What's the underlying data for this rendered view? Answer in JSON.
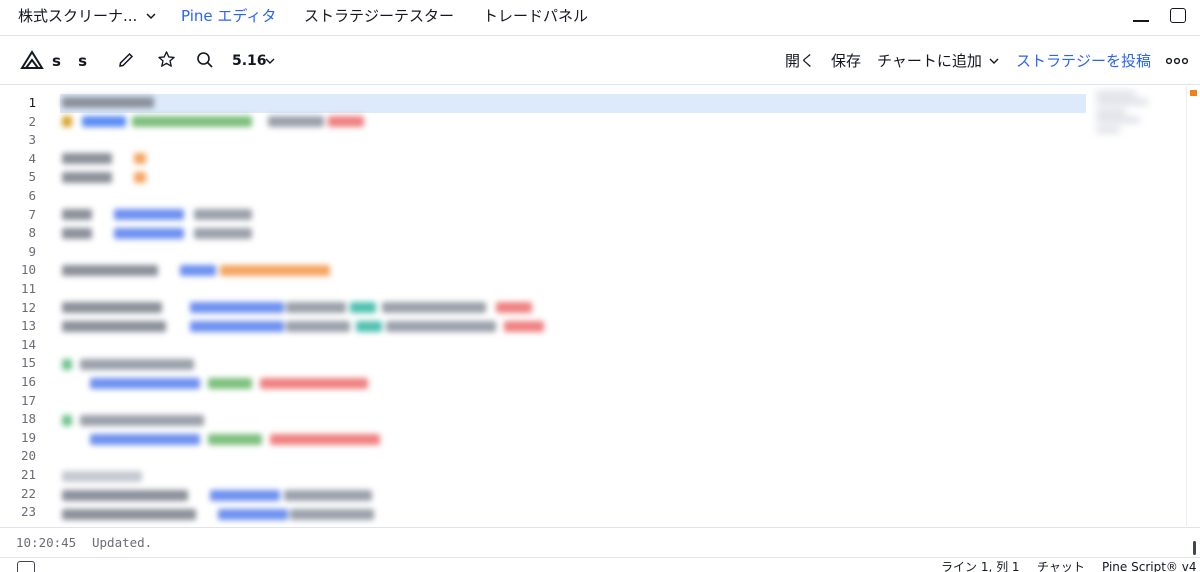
{
  "tabs": {
    "screener": "株式スクリーナ...",
    "pine_editor": "Pine エディタ",
    "strategy_tester": "ストラテジーテスター",
    "trading_panel": "トレードパネル"
  },
  "toolbar": {
    "script_name": "s s",
    "version": "5.16",
    "open_label": "開く",
    "save_label": "保存",
    "add_to_chart_label": "チャートに追加",
    "publish_label": "ストラテジーを投稿"
  },
  "editor": {
    "line_numbers": [
      "1",
      "2",
      "3",
      "4",
      "5",
      "6",
      "7",
      "8",
      "9",
      "10",
      "11",
      "12",
      "13",
      "14",
      "15",
      "16",
      "17",
      "18",
      "19",
      "20",
      "21",
      "22",
      "23"
    ],
    "active_line": 1
  },
  "console": {
    "time": "10:20:45",
    "message": "Updated."
  },
  "status_bar": {
    "cursor_position": "ライン 1, 列 1",
    "chat_label": "チャット",
    "language_version": "Pine Script® v4"
  },
  "colors": {
    "accent": "#2962ff",
    "current_line": "#dceafb",
    "marker": "#f57f17"
  }
}
